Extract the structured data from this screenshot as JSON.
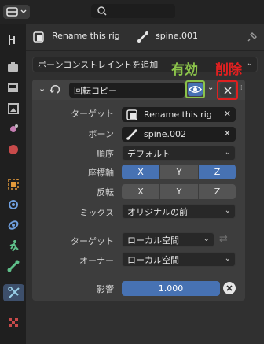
{
  "header": {
    "search_placeholder": "",
    "breadcrumb_object": "Rename this rig",
    "breadcrumb_bone": "spine.001"
  },
  "add_constraint": "ボーンコンストレイントを追加",
  "annotations": {
    "enable_label": "有効",
    "delete_label": "削除",
    "enable_color": "#8bc34a",
    "delete_color": "#e02020"
  },
  "constraint": {
    "name": "回転コピー",
    "target_label": "ターゲット",
    "target_value": "Rename this rig",
    "bone_label": "ボーン",
    "bone_value": "spine.002",
    "order_label": "順序",
    "order_value": "デフォルト",
    "axis_label": "座標軸",
    "invert_label": "反転",
    "axes": [
      "X",
      "Y",
      "Z"
    ],
    "mix_label": "ミックス",
    "mix_value": "オリジナルの前",
    "target_space_label": "ターゲット",
    "target_space_value": "ローカル空間",
    "owner_space_label": "オーナー",
    "owner_space_value": "ローカル空間",
    "influence_label": "影響",
    "influence_value": "1.000"
  },
  "tabs": [
    "tool-icon",
    "render-icon",
    "output-icon",
    "view-layer-icon",
    "scene-icon",
    "world-icon",
    "object-icon",
    "modifier-icon",
    "particles-icon",
    "physics-icon",
    "constraint-icon",
    "bone-icon",
    "bone-constraint-icon",
    "texture-icon"
  ]
}
